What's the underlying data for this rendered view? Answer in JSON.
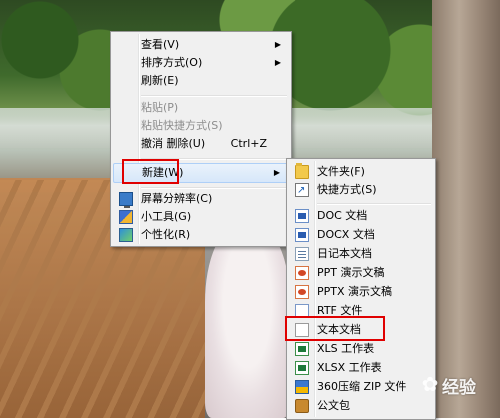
{
  "context_menu": {
    "items": [
      {
        "label": "查看(V)",
        "submenu": true
      },
      {
        "label": "排序方式(O)",
        "submenu": true
      },
      {
        "label": "刷新(E)"
      },
      {
        "label": "粘贴(P)",
        "disabled": true
      },
      {
        "label": "粘贴快捷方式(S)",
        "disabled": true
      },
      {
        "label": "撤消 删除(U)",
        "shortcut": "Ctrl+Z"
      },
      {
        "label": "新建(W)",
        "submenu": true,
        "highlighted": true
      },
      {
        "label": "屏幕分辨率(C)",
        "icon": "display-icon"
      },
      {
        "label": "小工具(G)",
        "icon": "gadget-icon"
      },
      {
        "label": "个性化(R)",
        "icon": "personalize-icon"
      }
    ]
  },
  "new_submenu": {
    "items": [
      {
        "label": "文件夹(F)",
        "icon": "folder-icon"
      },
      {
        "label": "快捷方式(S)",
        "icon": "shortcut-icon"
      },
      {
        "label": "DOC 文档",
        "icon": "word-doc-icon"
      },
      {
        "label": "DOCX 文档",
        "icon": "word-docx-icon"
      },
      {
        "label": "日记本文档",
        "icon": "journal-icon"
      },
      {
        "label": "PPT 演示文稿",
        "icon": "ppt-icon"
      },
      {
        "label": "PPTX 演示文稿",
        "icon": "pptx-icon"
      },
      {
        "label": "RTF 文件",
        "icon": "rtf-icon"
      },
      {
        "label": "文本文档",
        "icon": "text-doc-icon",
        "annotated": true
      },
      {
        "label": "XLS 工作表",
        "icon": "xls-icon"
      },
      {
        "label": "XLSX 工作表",
        "icon": "xlsx-icon"
      },
      {
        "label": "360压缩 ZIP 文件",
        "icon": "zip-icon"
      },
      {
        "label": "公文包",
        "icon": "briefcase-icon"
      }
    ]
  },
  "annotation_color": "#e00000",
  "watermark": {
    "text": "经验"
  }
}
